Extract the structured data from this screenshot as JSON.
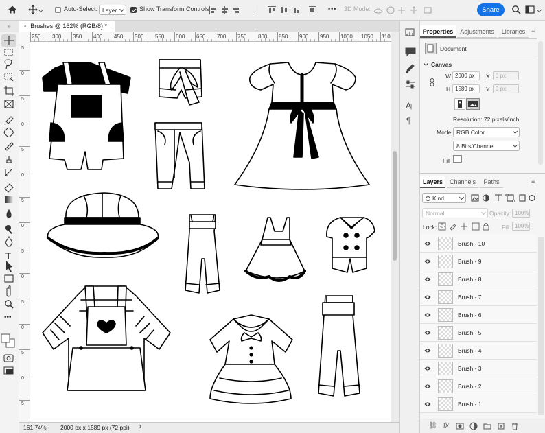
{
  "options_bar": {
    "auto_select_label": "Auto-Select:",
    "auto_select_value": "Layer",
    "show_transform_label": "Show Transform Controls",
    "mode_3d_label": "3D Mode:",
    "share_label": "Share",
    "more_glyph": "•••"
  },
  "document": {
    "tab_title": "Brushes @ 162% (RGB/8) *",
    "close_glyph": "×",
    "zoom": "161,74%",
    "info": "2000 px x 1589 px (72 ppi)",
    "ruler_ticks": [
      "250",
      "300",
      "350",
      "400",
      "450",
      "500",
      "550",
      "600",
      "650",
      "700",
      "750",
      "800",
      "850",
      "900",
      "950",
      "1000",
      "1050",
      "110"
    ],
    "ruler_left_ticks": [
      "5",
      "0",
      "5",
      "0",
      "5",
      "0",
      "5",
      "0",
      "5",
      "0",
      "5",
      "0",
      "5",
      "0",
      "5"
    ]
  },
  "properties_panel": {
    "tabs": [
      "Properties",
      "Adjustments",
      "Libraries"
    ],
    "active_tab": "Properties",
    "document_label": "Document",
    "canvas_heading": "Canvas",
    "w_label": "W",
    "w_value": "2000 px",
    "x_label": "X",
    "x_placeholder": "0 px",
    "h_label": "H",
    "h_value": "1589 px",
    "y_label": "Y",
    "y_placeholder": "0 px",
    "resolution": "Resolution: 72 pixels/inch",
    "mode_label": "Mode",
    "mode_value": "RGB Color",
    "depth_value": "8 Bits/Channel",
    "fill_label": "Fill"
  },
  "layers_panel": {
    "tabs": [
      "Layers",
      "Channels",
      "Paths"
    ],
    "active_tab": "Layers",
    "filter_kind": "Kind",
    "blend_mode": "Normal",
    "opacity_label": "Opacity:",
    "opacity_value": "100%",
    "lock_label": "Lock:",
    "fill_label": "Fill:",
    "fill_value": "100%",
    "layers": [
      {
        "name": "Brush - 10"
      },
      {
        "name": "Brush - 9"
      },
      {
        "name": "Brush - 8"
      },
      {
        "name": "Brush - 7"
      },
      {
        "name": "Brush - 6"
      },
      {
        "name": "Brush - 5"
      },
      {
        "name": "Brush - 4"
      },
      {
        "name": "Brush - 3"
      },
      {
        "name": "Brush - 2"
      },
      {
        "name": "Brush - 1"
      }
    ],
    "footer_fx": "fx"
  },
  "left_toolbar": {
    "tools": [
      "move-tool",
      "marquee-tool",
      "lasso-tool",
      "object-select-tool",
      "crop-tool",
      "frame-tool",
      "eyedropper-tool",
      "healing-brush-tool",
      "brush-tool",
      "clone-stamp-tool",
      "history-brush-tool",
      "eraser-tool",
      "gradient-tool",
      "blur-tool",
      "dodge-tool",
      "pen-tool",
      "type-tool",
      "path-select-tool",
      "rectangle-tool",
      "hand-tool",
      "zoom-tool",
      "more-tools",
      "foreground-color",
      "quick-mask",
      "screen-mode"
    ]
  },
  "colors": {
    "accent": "#1473e6",
    "foreground": "#ffffff",
    "background": "#ffffff"
  }
}
